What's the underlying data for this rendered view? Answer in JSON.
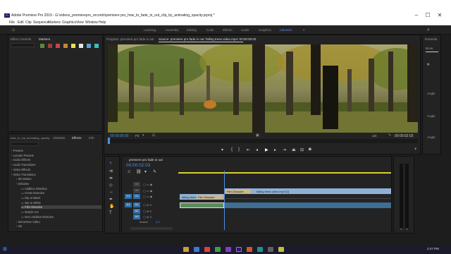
{
  "app_title": "Adobe Premiere Pro 2019 - G:\\videos_premierepro_records\\premiere pro_how_to_fade_in_out_clip_by_animating_opacity.prproj *",
  "menu": [
    "File",
    "Edit",
    "Clip",
    "Sequence",
    "Markers",
    "Graphics",
    "View",
    "Window",
    "Help"
  ],
  "workspaces": [
    "Learning",
    "Assembly",
    "Editing",
    "Color",
    "Effects",
    "Audio",
    "Graphics",
    "Libraries"
  ],
  "active_workspace": "Libraries",
  "left_panel": {
    "tabs": [
      "Effect Controls",
      "Markers"
    ],
    "marker_colors": [
      "#5b8c3a",
      "#a33b3b",
      "#c2464b",
      "#c7862f",
      "#e7e05a",
      "#e6e6e6",
      "#5aa3d6",
      "#3bc0c0"
    ]
  },
  "program_panel": {
    "tab_program": "Program: premiere pro fade in out",
    "tab_source": "Source: premiere pro fade in out: falling trees video.mp4: 00:00:00:00",
    "timecode_left": "00:00:00:00",
    "fit": "Fit",
    "ratio": "1/4",
    "timecode_right": "00:00:02:03"
  },
  "effects_panel": {
    "tabs": [
      "fade_in_out_animating_opacity",
      "Libraries",
      "Effects",
      "Info"
    ],
    "items": [
      {
        "label": "Presets",
        "level": 0
      },
      {
        "label": "Lumetri Presets",
        "level": 0
      },
      {
        "label": "Audio Effects",
        "level": 0
      },
      {
        "label": "Audio Transitions",
        "level": 0
      },
      {
        "label": "Video Effects",
        "level": 0
      },
      {
        "label": "Video Transitions",
        "level": 0
      },
      {
        "label": "3D Motion",
        "level": 1
      },
      {
        "label": "Dissolve",
        "level": 1
      },
      {
        "label": "Additive Dissolve",
        "level": 2
      },
      {
        "label": "Cross Dissolve",
        "level": 2
      },
      {
        "label": "Dip to Black",
        "level": 2
      },
      {
        "label": "Dip to White",
        "level": 2
      },
      {
        "label": "Film Dissolve",
        "level": 2,
        "selected": true
      },
      {
        "label": "Morph Cut",
        "level": 2
      },
      {
        "label": "Non-Additive Dissolve",
        "level": 2
      },
      {
        "label": "Immersive Video",
        "level": 1
      },
      {
        "label": "Iris",
        "level": 1
      }
    ]
  },
  "timeline": {
    "tab": "premiere pro fade in out",
    "timecode": "00:00:02:03",
    "tracks": [
      "V3",
      "V2",
      "V1",
      "A1",
      "A2",
      "A3"
    ],
    "master": "Master",
    "master_val": "0.0",
    "clips": {
      "v1_left": "falling trees",
      "v1_left_transition": "Film Dissolve",
      "v1_mid_transition": "Film Dissolve",
      "v1_right": "falling trees video.mp4 [V]"
    }
  },
  "audio_meter": {
    "labels": [
      "S",
      "S"
    ]
  },
  "clock": "2:47 PM"
}
